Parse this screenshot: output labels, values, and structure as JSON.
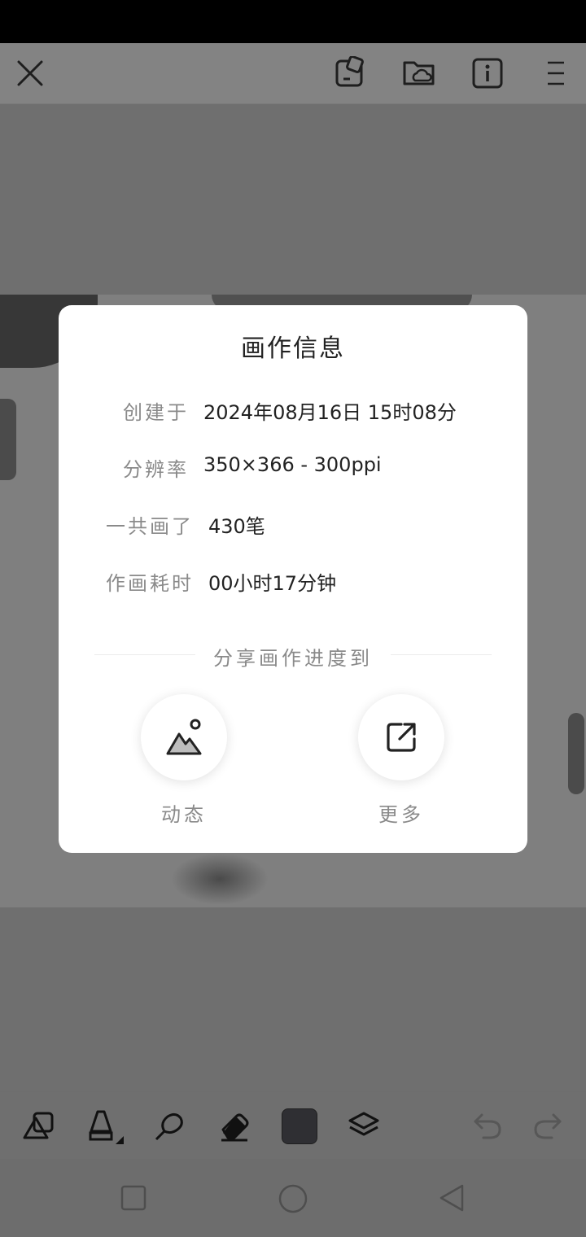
{
  "top_bar": {
    "close_icon": "close-icon",
    "icons": [
      "edit-export-icon",
      "cloud-folder-icon",
      "info-icon",
      "menu-icon"
    ]
  },
  "dialog": {
    "title": "画作信息",
    "rows": [
      {
        "label": "创建于",
        "value": "2024年08月16日 15时08分"
      },
      {
        "label": "分辨率",
        "value": "350×366 - 300ppi"
      },
      {
        "label": "一共画了",
        "value": "430笔"
      },
      {
        "label": "作画耗时",
        "value": "00小时17分钟"
      }
    ],
    "share_label": "分享画作进度到",
    "share_options": [
      {
        "label": "动态",
        "icon": "mountain-image-icon"
      },
      {
        "label": "更多",
        "icon": "external-share-icon"
      }
    ]
  },
  "bottom_toolbar": {
    "tools": [
      "shapes-tool-icon",
      "brush-tool-icon",
      "smudge-tool-icon",
      "eraser-tool-icon",
      "color-swatch",
      "layers-icon",
      "undo-icon",
      "redo-icon"
    ],
    "current_color": "#2f2f33"
  },
  "nav_bar": {
    "buttons": [
      "recent-apps-button",
      "home-button",
      "back-button"
    ]
  }
}
